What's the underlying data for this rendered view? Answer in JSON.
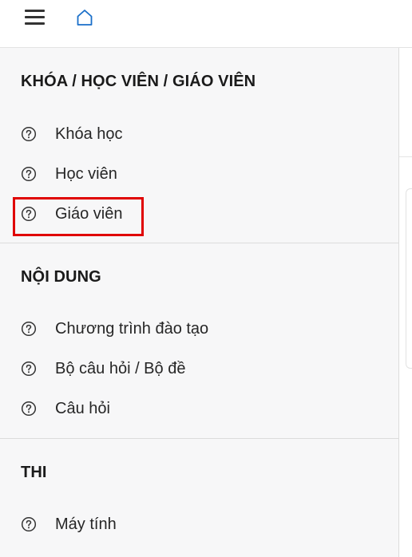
{
  "header": {
    "menu_icon": "hamburger-menu-icon",
    "home_icon": "home-icon"
  },
  "sections": [
    {
      "title": "KHÓA / HỌC VIÊN / GIÁO VIÊN",
      "items": [
        {
          "label": "Khóa học",
          "icon": "question-circle-icon"
        },
        {
          "label": "Học viên",
          "icon": "question-circle-icon"
        },
        {
          "label": "Giáo viên",
          "icon": "question-circle-icon",
          "highlighted": true
        }
      ]
    },
    {
      "title": "NỘI DUNG",
      "items": [
        {
          "label": "Chương trình đào tạo",
          "icon": "question-circle-icon"
        },
        {
          "label": "Bộ câu hỏi / Bộ đề",
          "icon": "question-circle-icon"
        },
        {
          "label": "Câu hỏi",
          "icon": "question-circle-icon"
        }
      ]
    },
    {
      "title": "THI",
      "items": [
        {
          "label": "Máy tính",
          "icon": "question-circle-icon"
        }
      ]
    }
  ],
  "colors": {
    "highlight_border": "#e00000",
    "drawer_background": "#f7f7f8",
    "icon_accent": "#1a6fc9"
  }
}
